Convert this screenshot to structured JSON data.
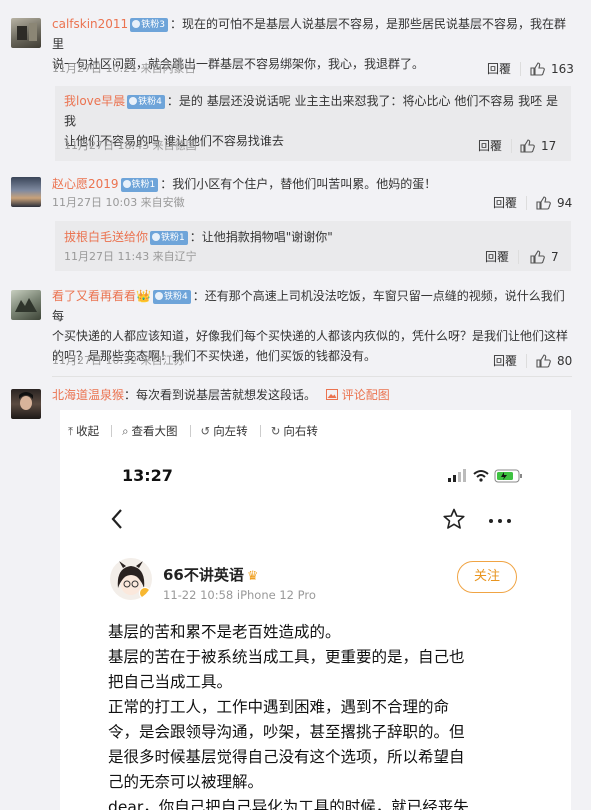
{
  "comments": [
    {
      "user": "calfskin2011",
      "badge": "铁粉3",
      "text_line1": "：现在的可怕不是基层人说基层不容易，是那些居民说基层不容易，我在群里",
      "text_line2": "说一句社区问题，就会跳出一群基层不容易绑架你，我心，我退群了。",
      "meta": "11月27日 10:21 来自内蒙古",
      "reply_label": "回覆",
      "likes": "163"
    },
    {
      "user": "我love早晨",
      "badge": "铁粉4",
      "text_line1": "：是的 基层还没说话呢 业主主出来怼我了：将心比心 他们不容易 我呸 是我",
      "text_line2": "让他们不容易的吗 谁让他们不容易找谁去",
      "meta": "11月27日 18:43 来自德国",
      "reply_label": "回覆",
      "likes": "17"
    },
    {
      "user": "赵心愿2019",
      "badge": "铁粉1",
      "text_line1": "：我们小区有个住户，替他们叫苦叫累。他妈的蛋！",
      "meta": "11月27日 10:03 来自安徽",
      "reply_label": "回覆",
      "likes": "94"
    },
    {
      "user": "拔根白毛送给你",
      "badge": "铁粉1",
      "text_line1": "：让他捐款捐物唱\"谢谢你\"",
      "meta": "11月27日 11:43 来自辽宁",
      "reply_label": "回覆",
      "likes": "7"
    },
    {
      "user": "看了又看再看看",
      "badge": "铁粉4",
      "text_line1": "：还有那个高速上司机没法吃饭，车窗只留一点缝的视频，说什么我们每",
      "text_line2": "个买快递的人都应该知道，好像我们每个买快递的人都该内疚似的，凭什么呀？是我们让他们这样",
      "text_line3": "的吗？是那些变态啊！我们不买快递，他们买饭的钱都没有。",
      "meta": "11月27日 10:32 来自江苏",
      "reply_label": "回覆",
      "likes": "80"
    },
    {
      "user": "北海道温泉猴",
      "text_line1": "：每次看到说基层苦就想发这段话。",
      "pic_comment_label": "评论配图"
    }
  ],
  "viewer": {
    "toolbar": [
      "收起",
      "查看大图",
      "向左转",
      "向右转"
    ],
    "phone_time": "13:27",
    "author_name": "66不讲英语",
    "author_sub": "11-22 10:58   iPhone 12 Pro",
    "follow_label": "关注",
    "body": [
      "基层的苦和累不是老百姓造成的。",
      "基层的苦在于被系统当成工具，更重要的是，自己也",
      "把自己当成工具。",
      "正常的打工人，工作中遇到困难，遇到不合理的命",
      "令，是会跟领导沟通，吵架，甚至撂挑子辞职的。但",
      "是很多时候基层觉得自己没有这个选项，所以希望自",
      "己的无奈可以被理解。",
      "dear，你自己把自己异化为工具的时候，就已经丧失"
    ]
  },
  "colors": {
    "username": "#eb7350",
    "badge": "#6ea4d9",
    "follow": "#f0a444"
  }
}
